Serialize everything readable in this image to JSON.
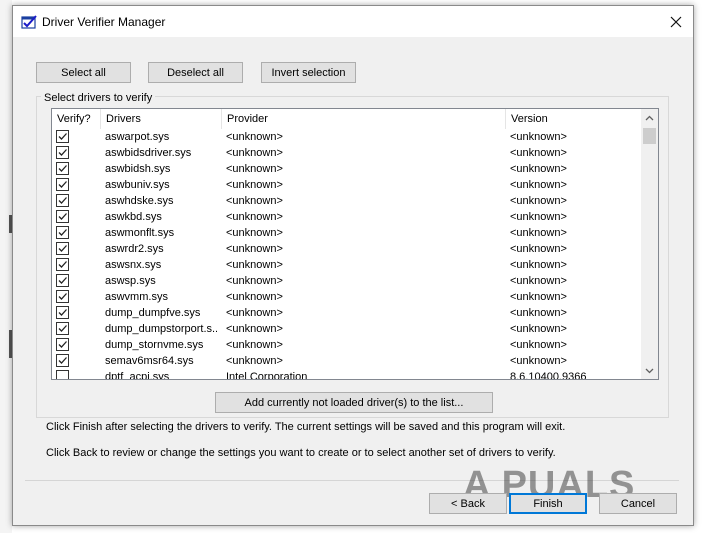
{
  "window": {
    "title": "Driver Verifier Manager",
    "close_icon": "close-icon"
  },
  "toolbar": {
    "select_all": "Select all",
    "deselect_all": "Deselect all",
    "invert_selection": "Invert selection"
  },
  "group": {
    "label": "Select drivers to verify"
  },
  "table": {
    "columns": [
      "Verify?",
      "Drivers",
      "Provider",
      "Version"
    ],
    "rows": [
      {
        "checked": true,
        "driver": "aswarpot.sys",
        "provider": "<unknown>",
        "version": "<unknown>"
      },
      {
        "checked": true,
        "driver": "aswbidsdriver.sys",
        "provider": "<unknown>",
        "version": "<unknown>"
      },
      {
        "checked": true,
        "driver": "aswbidsh.sys",
        "provider": "<unknown>",
        "version": "<unknown>"
      },
      {
        "checked": true,
        "driver": "aswbuniv.sys",
        "provider": "<unknown>",
        "version": "<unknown>"
      },
      {
        "checked": true,
        "driver": "aswhdske.sys",
        "provider": "<unknown>",
        "version": "<unknown>"
      },
      {
        "checked": true,
        "driver": "aswkbd.sys",
        "provider": "<unknown>",
        "version": "<unknown>"
      },
      {
        "checked": true,
        "driver": "aswmonflt.sys",
        "provider": "<unknown>",
        "version": "<unknown>"
      },
      {
        "checked": true,
        "driver": "aswrdr2.sys",
        "provider": "<unknown>",
        "version": "<unknown>"
      },
      {
        "checked": true,
        "driver": "aswsnx.sys",
        "provider": "<unknown>",
        "version": "<unknown>"
      },
      {
        "checked": true,
        "driver": "aswsp.sys",
        "provider": "<unknown>",
        "version": "<unknown>"
      },
      {
        "checked": true,
        "driver": "aswvmm.sys",
        "provider": "<unknown>",
        "version": "<unknown>"
      },
      {
        "checked": true,
        "driver": "dump_dumpfve.sys",
        "provider": "<unknown>",
        "version": "<unknown>"
      },
      {
        "checked": true,
        "driver": "dump_dumpstorport.s...",
        "provider": "<unknown>",
        "version": "<unknown>"
      },
      {
        "checked": true,
        "driver": "dump_stornvme.sys",
        "provider": "<unknown>",
        "version": "<unknown>"
      },
      {
        "checked": true,
        "driver": "semav6msr64.sys",
        "provider": "<unknown>",
        "version": "<unknown>"
      },
      {
        "checked": false,
        "driver": "dptf_acpi.sys",
        "provider": "Intel Corporation",
        "version": "8.6.10400.9366"
      }
    ]
  },
  "add_button": "Add currently not loaded driver(s) to the list...",
  "instructions": {
    "finish": "Click Finish after selecting the drivers to verify. The current settings will be saved and this program will exit.",
    "back": "Click Back to review or change the settings you want to create or to select another set of drivers to verify."
  },
  "footer": {
    "back": "< Back",
    "finish": "Finish",
    "cancel": "Cancel"
  },
  "watermark": "A PUALS",
  "colors": {
    "accent": "#0078d7",
    "dialog_bg": "#f0f0f0"
  }
}
